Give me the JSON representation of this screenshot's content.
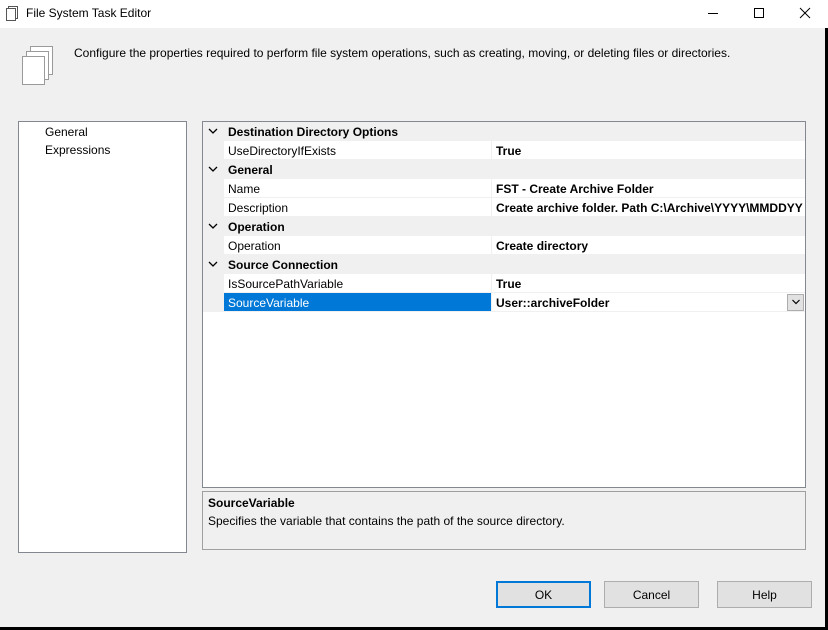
{
  "window": {
    "title": "File System Task Editor",
    "icon": "document-icon",
    "controls": {
      "minimize": "minimize-icon",
      "maximize": "maximize-icon",
      "close": "close-icon"
    }
  },
  "header": {
    "description": "Configure the properties required to perform file system operations, such as creating, moving, or deleting files or directories.",
    "icon": "documents-icon"
  },
  "nav": {
    "items": [
      {
        "label": "General",
        "selected": true
      },
      {
        "label": "Expressions",
        "selected": false
      }
    ]
  },
  "grid": {
    "categories": [
      {
        "label": "Destination Directory Options",
        "properties": [
          {
            "name": "UseDirectoryIfExists",
            "value": "True"
          }
        ]
      },
      {
        "label": "General",
        "properties": [
          {
            "name": "Name",
            "value": "FST - Create Archive Folder"
          },
          {
            "name": "Description",
            "value": "Create archive folder.  Path C:\\Archive\\YYYY\\MMDDYY"
          }
        ]
      },
      {
        "label": "Operation",
        "properties": [
          {
            "name": "Operation",
            "value": "Create directory"
          }
        ]
      },
      {
        "label": "Source Connection",
        "properties": [
          {
            "name": "IsSourcePathVariable",
            "value": "True"
          },
          {
            "name": "SourceVariable",
            "value": "User::archiveFolder"
          }
        ]
      }
    ],
    "selected_property": "SourceVariable"
  },
  "description_panel": {
    "title": "SourceVariable",
    "text": "Specifies the variable that contains the path of the source directory."
  },
  "buttons": {
    "ok": "OK",
    "cancel": "Cancel",
    "help": "Help"
  },
  "colors": {
    "selection": "#0078d7",
    "category_bg": "#f0f0f0",
    "window_bg": "#f0f0f0"
  }
}
